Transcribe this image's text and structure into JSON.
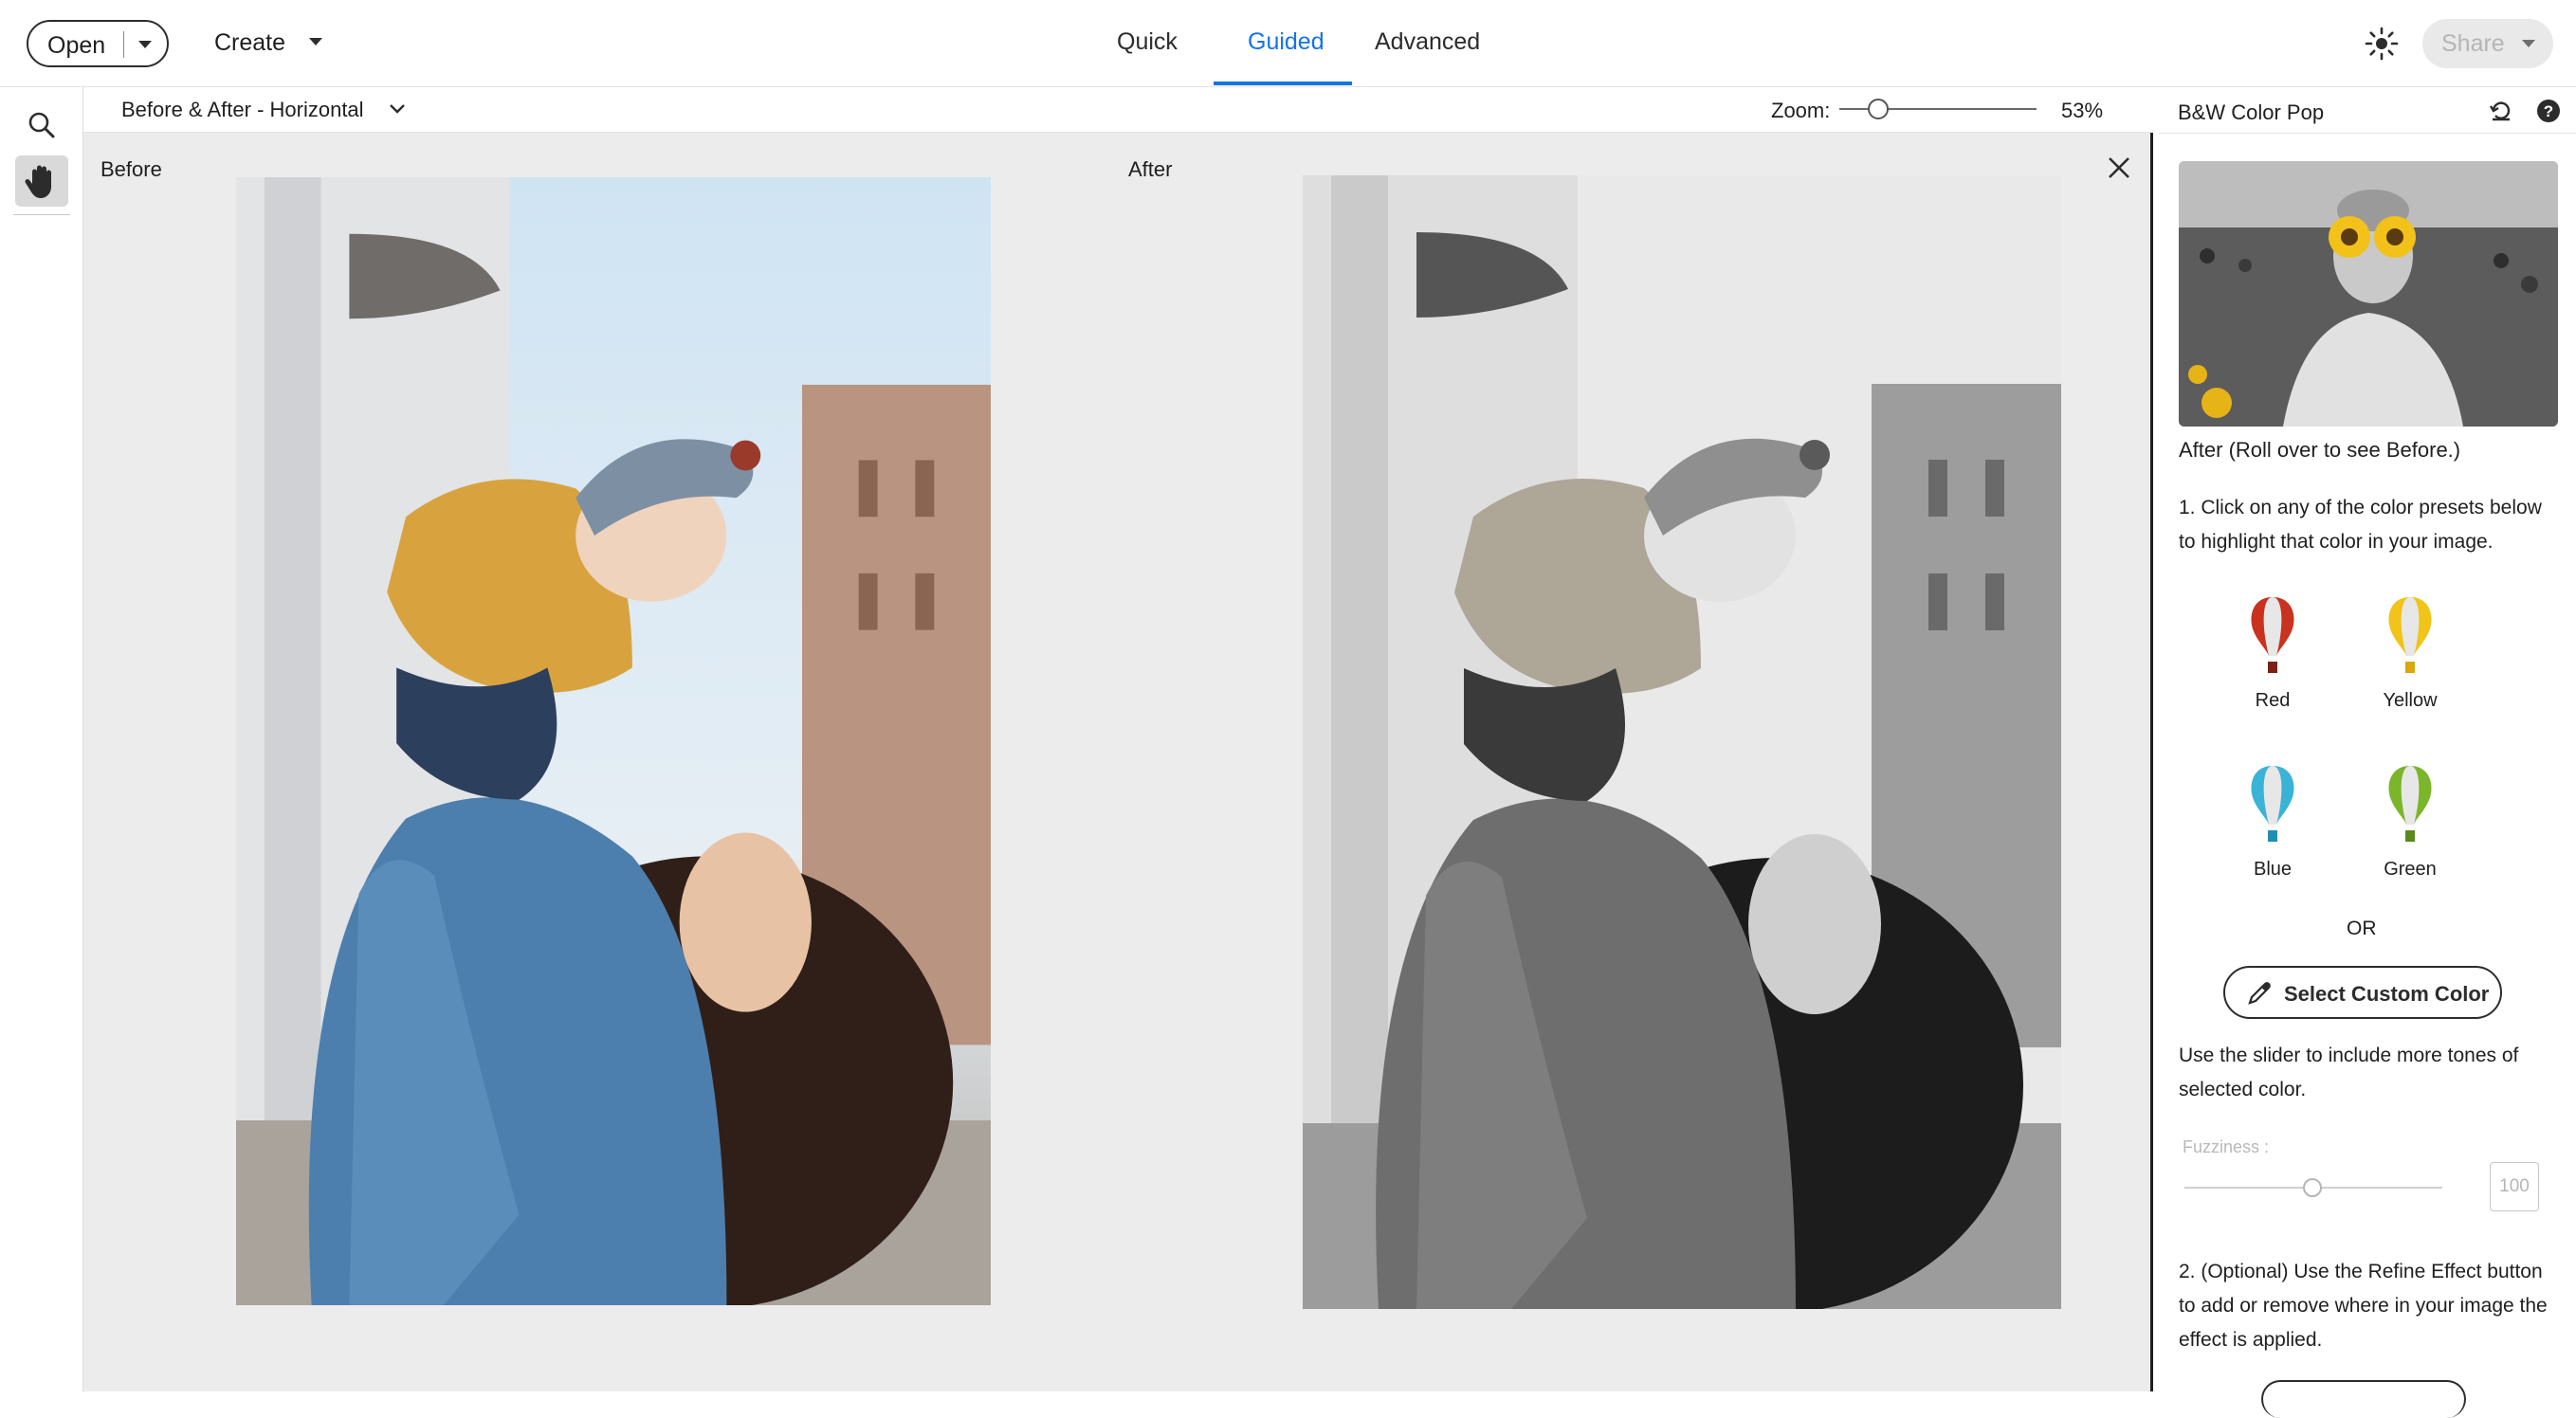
{
  "topbar": {
    "open_label": "Open",
    "create_label": "Create",
    "tabs": [
      {
        "label": "Quick"
      },
      {
        "label": "Guided",
        "active": true
      },
      {
        "label": "Advanced"
      }
    ],
    "share_label": "Share",
    "accent_color": "#1473e6"
  },
  "viewbar": {
    "view_mode": "Before & After - Horizontal",
    "zoom_label": "Zoom:",
    "zoom_value": "53%",
    "zoom_level": 53
  },
  "canvas": {
    "before_label": "Before",
    "after_label": "After"
  },
  "panel": {
    "title": "B&W Color Pop",
    "preview_caption": "After (Roll over to see Before.)",
    "step1": "1. Click on any of the color presets below to highlight that color in your image.",
    "presets": [
      {
        "label": "Red",
        "color": "#c8321e"
      },
      {
        "label": "Yellow",
        "color": "#f0c419"
      },
      {
        "label": "Blue",
        "color": "#3bb3d6"
      },
      {
        "label": "Green",
        "color": "#7ab52a"
      }
    ],
    "or_label": "OR",
    "custom_color_label": "Select Custom Color",
    "slider_text": "Use the slider to include more tones of selected color.",
    "fuzziness_label": "Fuzziness :",
    "fuzziness_value": "100",
    "fuzziness_level_fraction": 0.46,
    "step2": "2. (Optional) Use the Refine Effect button to add or remove where in your image the effect is applied."
  },
  "icons": [
    "search-icon",
    "hand-icon",
    "sun-icon",
    "chevron-down-icon",
    "close-icon",
    "reset-icon",
    "help-icon",
    "eyedropper-icon",
    "balloon-icon"
  ]
}
